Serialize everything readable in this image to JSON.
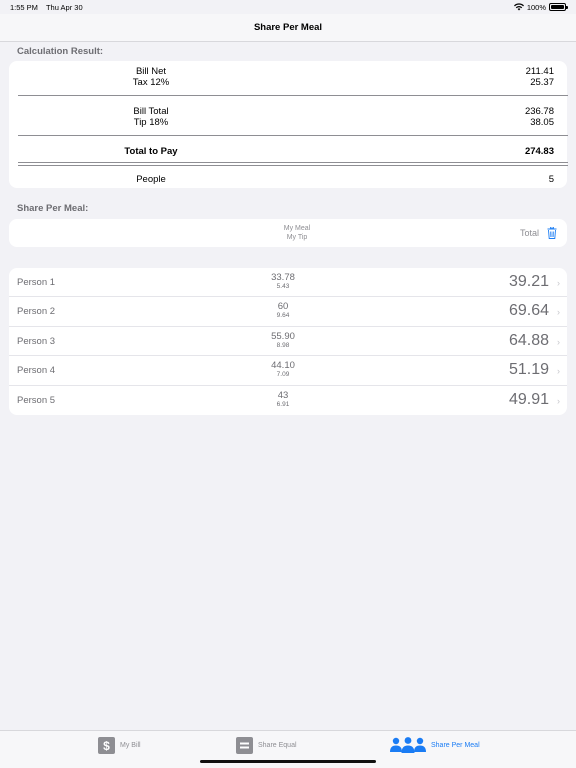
{
  "status": {
    "time": "1:55 PM",
    "date": "Thu Apr 30",
    "battery": "100%"
  },
  "nav": {
    "title": "Share Per Meal"
  },
  "calc": {
    "header": "Calculation Result:",
    "bill_net_label": "Bill Net",
    "bill_net": "211.41",
    "tax_label": "Tax 12%",
    "tax": "25.37",
    "bill_total_label": "Bill Total",
    "bill_total": "236.78",
    "tip_label": "Tip 18%",
    "tip": "38.05",
    "total_label": "Total to Pay",
    "total": "274.83",
    "people_label": "People",
    "people": "5"
  },
  "share": {
    "header": "Share Per Meal:",
    "col_meal": "My Meal",
    "col_tip": "My Tip",
    "col_total": "Total"
  },
  "persons": [
    {
      "name": "Person 1",
      "meal": "33.78",
      "tip": "5.43",
      "total": "39.21"
    },
    {
      "name": "Person 2",
      "meal": "60",
      "tip": "9.64",
      "total": "69.64"
    },
    {
      "name": "Person 3",
      "meal": "55.90",
      "tip": "8.98",
      "total": "64.88"
    },
    {
      "name": "Person 4",
      "meal": "44.10",
      "tip": "7.09",
      "total": "51.19"
    },
    {
      "name": "Person 5",
      "meal": "43",
      "tip": "6.91",
      "total": "49.91"
    }
  ],
  "tabs": [
    {
      "label": "My Bill",
      "icon": "dollar-icon"
    },
    {
      "label": "Share Equal",
      "icon": "equals-icon"
    },
    {
      "label": "Share Per Meal",
      "icon": "people-icon",
      "active": true
    }
  ],
  "colors": {
    "accent": "#1a7cf4",
    "background": "#f2f2f6"
  }
}
